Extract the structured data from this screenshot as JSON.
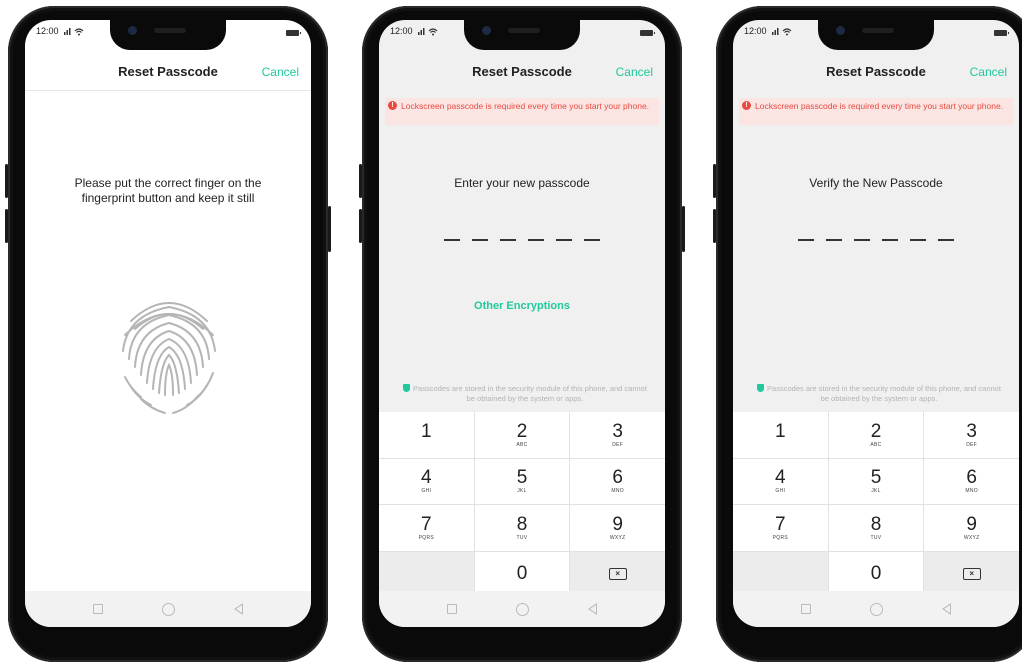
{
  "status_time": "12:00",
  "header_title": "Reset Passcode",
  "cancel_label": "Cancel",
  "warning_text": "Lockscreen passcode is required every time you start your phone.",
  "screen1": {
    "prompt": "Please put the correct finger on the fingerprint button and keep it still"
  },
  "screen2": {
    "prompt": "Enter your new passcode",
    "other_encryptions": "Other Encryptions"
  },
  "screen3": {
    "prompt": "Verify the New Passcode"
  },
  "secure_note": "Passcodes are stored in the security module of this phone, and cannot be obtained by the system or apps.",
  "keys": [
    {
      "num": "1",
      "letters": ""
    },
    {
      "num": "2",
      "letters": "ABC"
    },
    {
      "num": "3",
      "letters": "DEF"
    },
    {
      "num": "4",
      "letters": "GHI"
    },
    {
      "num": "5",
      "letters": "JKL"
    },
    {
      "num": "6",
      "letters": "MNO"
    },
    {
      "num": "7",
      "letters": "PQRS"
    },
    {
      "num": "8",
      "letters": "TUV"
    },
    {
      "num": "9",
      "letters": "WXYZ"
    },
    {
      "num": "0",
      "letters": ""
    }
  ],
  "colors": {
    "accent": "#1fc99c",
    "warning": "#e84a3f",
    "warning_bg": "#fbe5e3"
  },
  "icons": {
    "status": [
      "signal-icon",
      "wifi-icon",
      "battery-icon"
    ],
    "keypad_backspace": "backspace-icon",
    "navbar": [
      "recent-apps-icon",
      "home-icon",
      "back-icon"
    ]
  }
}
